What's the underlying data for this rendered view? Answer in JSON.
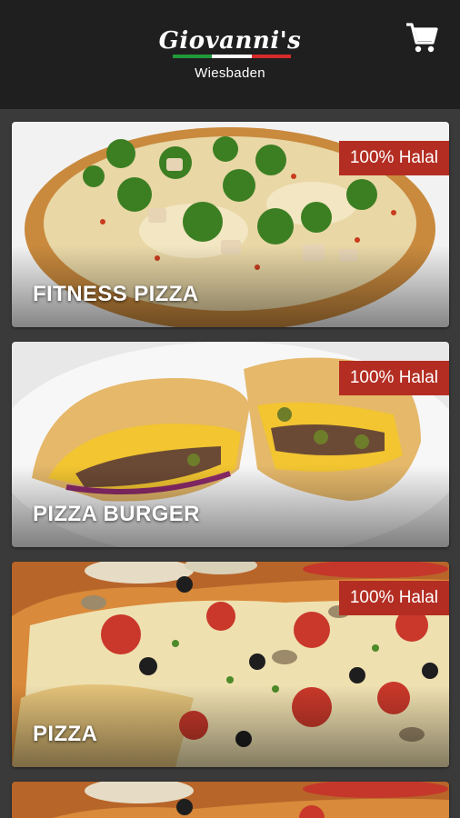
{
  "header": {
    "logo_text": "Giovanni's",
    "city": "Wiesbaden",
    "flag_colors": [
      "#1f9a3a",
      "#ffffff",
      "#d62b2b"
    ],
    "cart_icon": "shopping-cart-icon",
    "background": "#1f1f1f"
  },
  "categories": [
    {
      "title": "FITNESS PIZZA",
      "badge": "100% Halal"
    },
    {
      "title": "PIZZA BURGER",
      "badge": "100% Halal"
    },
    {
      "title": "PIZZA",
      "badge": "100% Halal"
    }
  ],
  "colors": {
    "badge": "#b32d22",
    "list_background": "#3a3a3a"
  }
}
